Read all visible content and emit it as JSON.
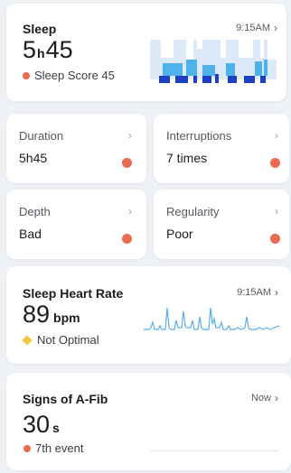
{
  "sleep": {
    "title": "Sleep",
    "time": "9:15AM",
    "hours": "5",
    "hours_unit": "h",
    "minutes": "45",
    "score_label": "Sleep Score 45",
    "status_color": "#ea6a52"
  },
  "tiles": [
    {
      "label": "Duration",
      "value": "5h45"
    },
    {
      "label": "Interruptions",
      "value": "7 times"
    },
    {
      "label": "Depth",
      "value": "Bad"
    },
    {
      "label": "Regularity",
      "value": "Poor"
    }
  ],
  "heart_rate": {
    "title": "Sleep Heart Rate",
    "time": "9:15AM",
    "value": "89",
    "unit": "bpm",
    "status": "Not Optimal",
    "line_color": "#5aaee6"
  },
  "afib": {
    "title": "Signs of A-Fib",
    "time": "Now",
    "value": "30",
    "unit": "s",
    "status": "7th event"
  },
  "icons": {
    "chevron": "›"
  }
}
